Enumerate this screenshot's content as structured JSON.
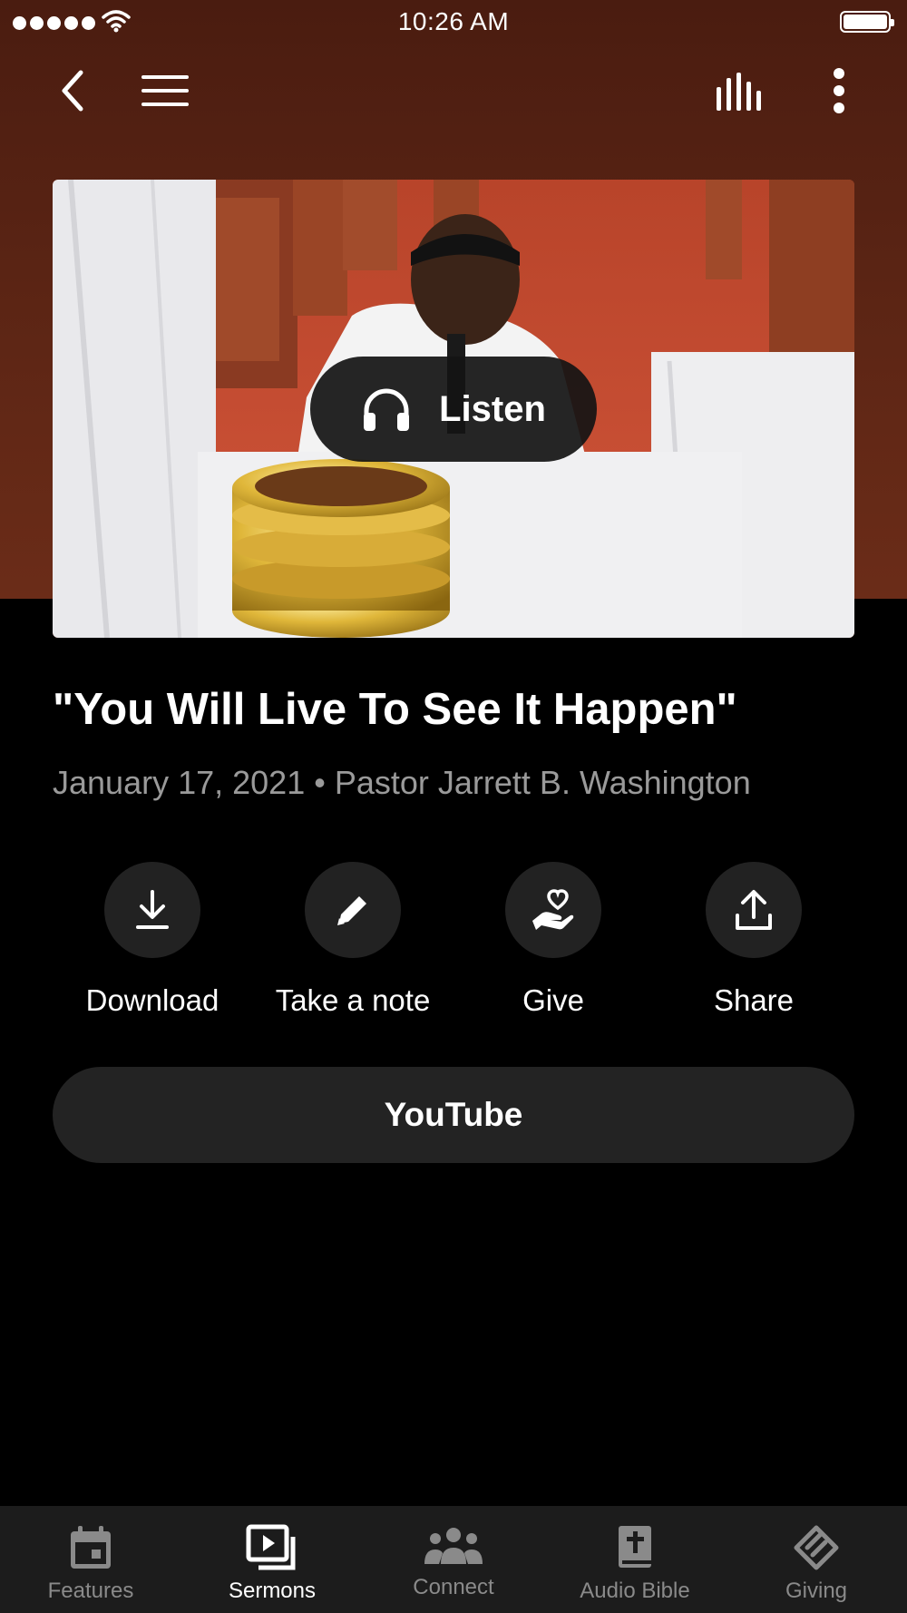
{
  "status_bar": {
    "time": "10:26 AM"
  },
  "nav": {
    "back": "back-icon",
    "menu": "menu-icon",
    "audio": "audio-bars-icon",
    "more": "more-vertical-icon"
  },
  "colors": {
    "header": "#5a2414",
    "button_bg": "#222222",
    "tab_bar": "#1c1c1c"
  },
  "hero": {
    "listen_label": "Listen",
    "listen_icon": "headphones-icon"
  },
  "sermon": {
    "title": "\"You Will Live To See It Happen\"",
    "date": "January 17, 2021",
    "separator": "•",
    "speaker": "Pastor Jarrett B. Washington"
  },
  "actions": [
    {
      "label": "Download",
      "icon": "download-icon"
    },
    {
      "label": "Take a note",
      "icon": "pencil-icon"
    },
    {
      "label": "Give",
      "icon": "heart-hand-icon"
    },
    {
      "label": "Share",
      "icon": "share-icon"
    }
  ],
  "youtube_label": "YouTube",
  "tabs": [
    {
      "label": "Features",
      "icon": "calendar-icon",
      "active": false
    },
    {
      "label": "Sermons",
      "icon": "video-library-icon",
      "active": true
    },
    {
      "label": "Connect",
      "icon": "people-icon",
      "active": false
    },
    {
      "label": "Audio Bible",
      "icon": "bible-icon",
      "active": false
    },
    {
      "label": "Giving",
      "icon": "giving-icon",
      "active": false
    }
  ]
}
